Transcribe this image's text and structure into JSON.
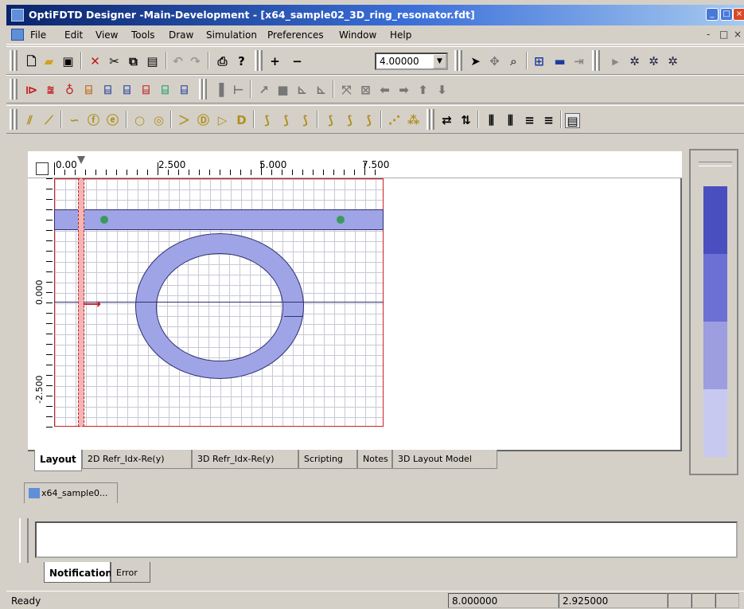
{
  "window": {
    "title": "OptiFDTD Designer -Main-Development - [x64_sample02_3D_ring_resonator.fdt]",
    "buttons": [
      "_",
      "□",
      "×"
    ]
  },
  "menu": {
    "items": [
      "File",
      "Edit",
      "View",
      "Tools",
      "Draw",
      "Simulation",
      "Preferences",
      "Window",
      "Help"
    ],
    "mdi_controls": [
      "-",
      "□",
      "×"
    ]
  },
  "toolbar": {
    "zoom_value": "4.00000",
    "row1_icons": [
      "new-icon",
      "open-icon",
      "save-icon",
      "delete-icon",
      "cut-icon",
      "copy-icon",
      "paste-icon",
      "undo-icon",
      "redo-icon",
      "print-icon",
      "help-icon",
      "zoom-in-icon",
      "zoom-out-icon",
      "zoom-dropdown-icon",
      "select-icon",
      "pan-icon",
      "zoom-tool-icon",
      "grid-icon",
      "input-plane-icon",
      "observation-icon",
      "run-icon",
      "simulate-icon",
      "simulate2-icon",
      "simulate3-icon"
    ],
    "row2_icons": [
      "wafer-icon",
      "material-icon",
      "profile-icon",
      "channel-icon",
      "waveguide-array-icon",
      "waveguide-array2-icon",
      "taper-icon",
      "lens-icon",
      "lens2-icon",
      "align-left-icon",
      "align-bottom-icon",
      "measure-icon",
      "fill-icon",
      "edge-icon",
      "edge2-icon",
      "rotate-icon",
      "fit-icon",
      "arrow-left-icon",
      "arrow-right-icon",
      "arrow-up-icon",
      "arrow-down-icon"
    ],
    "row3_icons": [
      "linear-wg-icon",
      "arc-wg-icon",
      "s-bend-icon",
      "function-wg-icon",
      "expression-wg-icon",
      "ellipse-icon",
      "ring-icon",
      "taper-wg-icon",
      "mmi-icon",
      "diamond-icon",
      "polygon-icon",
      "bend1-icon",
      "bend2-icon",
      "bend3-icon",
      "bend4-icon",
      "bend5-icon",
      "bend6-icon",
      "group-icon",
      "array-icon",
      "flip-h-icon",
      "flip-v-icon",
      "distribute-icon",
      "distribute2-icon",
      "spacing-icon",
      "spacing2-icon",
      "properties-icon"
    ]
  },
  "ruler": {
    "h_labels": [
      "0.00",
      "2.500",
      "5.000",
      "7.500"
    ],
    "v_labels": [
      "0.000",
      "-2.500"
    ]
  },
  "tabs": [
    "Layout",
    "2D Refr_Idx-Re(y)",
    "3D Refr_Idx-Re(y)",
    "Scripting",
    "Notes",
    "3D Layout Model"
  ],
  "document_tab": "x64_sample0...",
  "legend_colors": [
    "#4a4fc0",
    "#6c70d4",
    "#9c9ee0",
    "#c8c9f0"
  ],
  "notification_tabs": [
    "Notification",
    "Error"
  ],
  "status": {
    "text": "Ready",
    "x": "8.000000",
    "y": "2.925000"
  }
}
